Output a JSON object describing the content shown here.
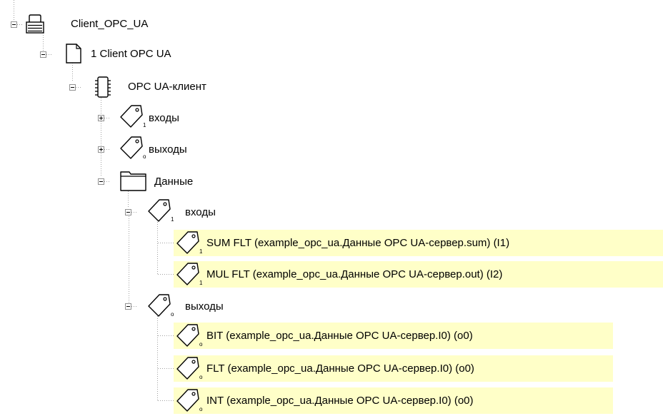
{
  "tree": {
    "root": {
      "label": "Client_OPC_UA",
      "icon": "device-stack-icon"
    },
    "client": {
      "label": "1 Client OPC UA",
      "icon": "page-icon"
    },
    "module": {
      "label": "OPC UA-клиент",
      "icon": "chip-icon"
    },
    "inputs_group": {
      "label": "входы",
      "icon": "tag-input-icon"
    },
    "outputs_group": {
      "label": "выходы",
      "icon": "tag-output-icon"
    },
    "data_folder": {
      "label": "Данные",
      "icon": "folder-icon"
    },
    "data_inputs": {
      "label": "входы",
      "items": [
        {
          "label": "SUM FLT (example_opc_ua.Данные OPC UA-сервер.sum)  (I1)"
        },
        {
          "label": "MUL FLT (example_opc_ua.Данные OPC UA-сервер.out)  (I2)"
        }
      ]
    },
    "data_outputs": {
      "label": "выходы",
      "items": [
        {
          "label": "BIT (example_opc_ua.Данные OPC UA-сервер.I0)  (o0)"
        },
        {
          "label": "FLT (example_opc_ua.Данные OPC UA-сервер.I0)  (o0)"
        },
        {
          "label": "INT (example_opc_ua.Данные OPC UA-сервер.I0)  (o0)"
        }
      ]
    }
  },
  "colors": {
    "highlight": "#ffffc8",
    "guide": "#a0a0a0"
  }
}
